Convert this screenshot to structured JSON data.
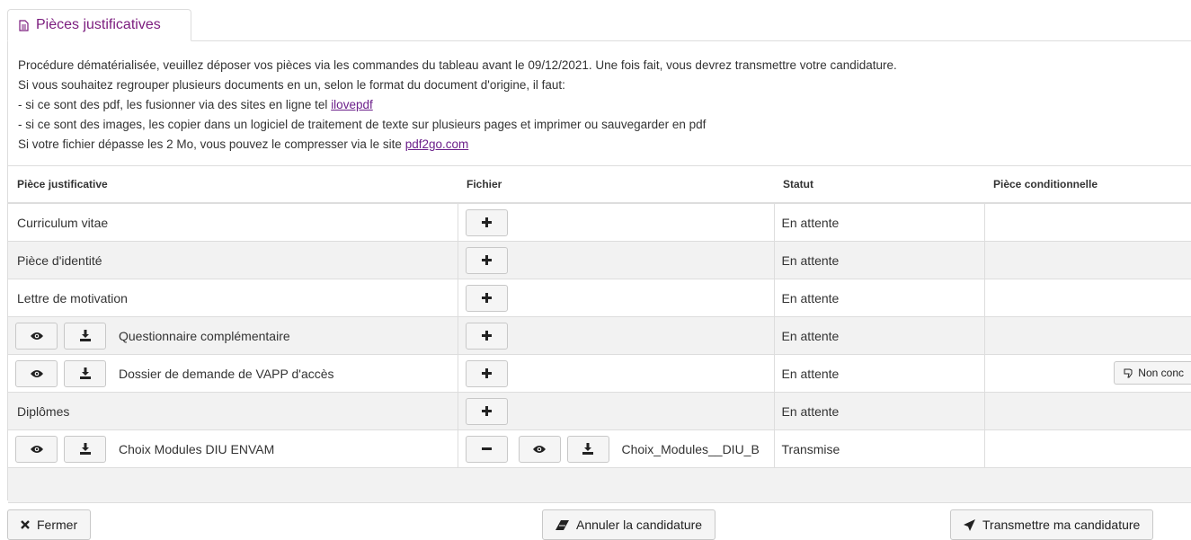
{
  "tab": {
    "title": "Pièces justificatives",
    "icon": "document-icon"
  },
  "intro": {
    "line1": "Procédure dématérialisée, veuillez déposer vos pièces via les commandes du tableau avant le 09/12/2021. Une fois fait, vous devrez transmettre votre candidature.",
    "line2": "Si vous souhaitez regrouper plusieurs documents en un, selon le format du document d'origine, il faut:",
    "line3_text": "- si ce sont des pdf, les fusionner via des sites en ligne tel ",
    "line3_link": "ilovepdf",
    "line4": "- si ce sont des images, les copier dans un logiciel de traitement de texte sur plusieurs pages et imprimer ou sauvegarder en pdf",
    "line5_text": "Si votre fichier dépasse les 2 Mo, vous pouvez le compresser via le site ",
    "line5_link": "pdf2go.com"
  },
  "table": {
    "headers": [
      "Pièce justificative",
      "Fichier",
      "Statut",
      "Pièce conditionnelle"
    ],
    "rows": [
      {
        "piece": "Curriculum vitae",
        "status": "En attente"
      },
      {
        "piece": "Pièce d'identité",
        "status": "En attente"
      },
      {
        "piece": "Lettre de motivation",
        "status": "En attente"
      },
      {
        "piece": "Questionnaire complémentaire",
        "status": "En attente"
      },
      {
        "piece": "Dossier de demande de VAPP d'accès",
        "status": "En attente",
        "conditional": "Non conc"
      },
      {
        "piece": "Diplômes",
        "status": "En attente"
      },
      {
        "piece": "Choix Modules DIU ENVAM",
        "file": "Choix_Modules__DIU_B",
        "status": "Transmise"
      }
    ]
  },
  "footer": {
    "close_label": "Fermer",
    "cancel_label": "Annuler la candidature",
    "submit_label": "Transmettre ma candidature"
  },
  "colors": {
    "accent": "#7b1c7e",
    "link": "#6b1f8a",
    "row_alt": "#f2f2f2"
  }
}
